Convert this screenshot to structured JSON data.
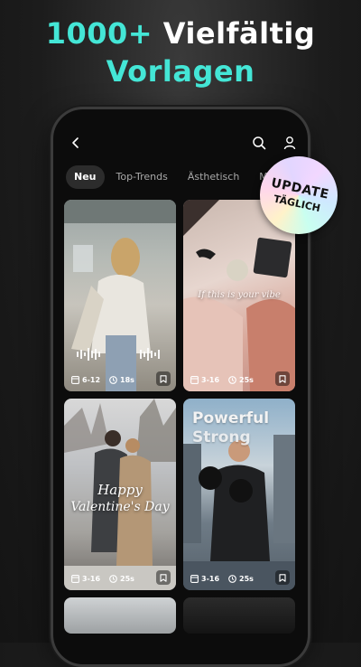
{
  "headline": {
    "line1_accent": "1000+",
    "line1_white": "Vielfältig",
    "line2": "Vorlagen"
  },
  "colors": {
    "accent": "#44e6d6",
    "background": "#1c1c1c",
    "tab_active_bg": "#2c2c2c"
  },
  "topbar": {
    "back_icon": "chevron-left-icon",
    "search_icon": "search-icon",
    "profile_icon": "user-icon"
  },
  "tabs": [
    {
      "label": "Neu",
      "active": true
    },
    {
      "label": "Top-Trends",
      "active": false
    },
    {
      "label": "Ästhetisch",
      "active": false
    },
    {
      "label": "Ma",
      "active": false
    }
  ],
  "badge": {
    "line1": "UPDATE",
    "line2": "TÄGLICH"
  },
  "cards": [
    {
      "clips": "6-12",
      "duration": "18s"
    },
    {
      "clips": "3-16",
      "duration": "25s",
      "caption": "If this is your vibe"
    },
    {
      "clips": "3-16",
      "duration": "25s",
      "caption_line1": "Happy",
      "caption_line2": "Valentine's Day"
    },
    {
      "clips": "3-16",
      "duration": "25s",
      "caption_line1": "Powerful",
      "caption_line2": "Strong"
    }
  ]
}
